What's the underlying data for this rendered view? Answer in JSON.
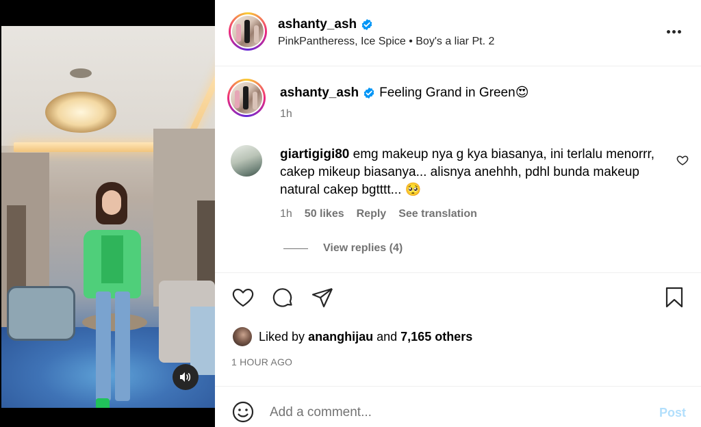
{
  "post": {
    "username": "ashanty_ash",
    "audio": "PinkPantheress, Ice Spice • Boy's a liar Pt. 2",
    "caption": {
      "username": "ashanty_ash",
      "text": "Feeling Grand in Green",
      "emoji": "😍",
      "time": "1h"
    },
    "comment": {
      "username": "giartigigi80",
      "text": "emg makeup nya g kya biasanya, ini terlalu menorrr, cakep mikeup biasanya... alisnya anehhh, pdhl bunda makeup natural cakep bgtttt...",
      "emoji": "🥺",
      "time": "1h",
      "likes": "50 likes",
      "reply": "Reply",
      "translation": "See translation",
      "view_replies": "View replies (4)"
    },
    "liked_by": {
      "prefix": "Liked by",
      "user": "ananghijau",
      "and": "and",
      "others": "7,165 others"
    },
    "timestamp": "1 HOUR AGO"
  },
  "composer": {
    "placeholder": "Add a comment...",
    "post_label": "Post"
  },
  "colors": {
    "verified": "#0095f6",
    "muted": "#737373",
    "post_disabled": "#b2dffc"
  },
  "icons": [
    "verified-badge-icon",
    "more-options-icon",
    "heart-icon",
    "comment-icon",
    "share-icon",
    "bookmark-icon",
    "emoji-icon",
    "speaker-icon"
  ]
}
